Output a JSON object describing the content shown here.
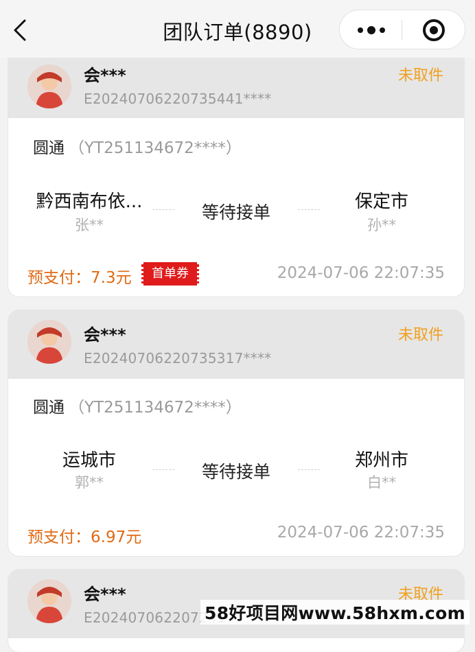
{
  "nav": {
    "title": "团队订单(8890)"
  },
  "orders": [
    {
      "user": "会***",
      "order_no": "E20240706220735441****",
      "status": "未取件",
      "courier": "圆通",
      "tracking": "（YT251134672****）",
      "from_city": "黔西南布依...",
      "from_person": "张**",
      "state": "等待接单",
      "to_city": "保定市",
      "to_person": "孙**",
      "prepay": "预支付：7.3元",
      "coupon": "首单券",
      "time": "2024-07-06 22:07:35"
    },
    {
      "user": "会***",
      "order_no": "E20240706220735317****",
      "status": "未取件",
      "courier": "圆通",
      "tracking": "（YT251134672****）",
      "from_city": "运城市",
      "from_person": "郭**",
      "state": "等待接单",
      "to_city": "郑州市",
      "to_person": "白**",
      "prepay": "预支付：6.97元",
      "time": "2024-07-06 22:07:35"
    },
    {
      "user": "会***",
      "order_no": "E2024070622072417",
      "status": "未取件"
    }
  ],
  "watermark": "58好项目网www.58hxm.com",
  "colors": {
    "status": "#f0a020",
    "prepay": "#e06a14",
    "coupon": "#e01b1b",
    "header_bg": "#e6e6e6"
  },
  "icons": {
    "back": "chevron-left-icon",
    "more": "more-dots-icon",
    "close": "target-close-icon",
    "avatar": "user-avatar"
  }
}
